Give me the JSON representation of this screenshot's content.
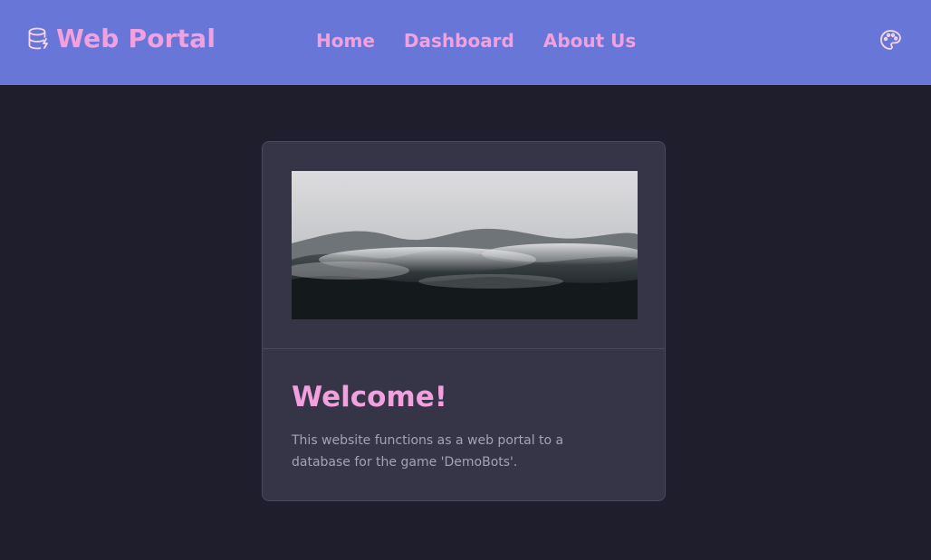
{
  "brand": {
    "title": "Web Portal",
    "icon": "database-bolt-icon"
  },
  "nav": {
    "links": [
      {
        "label": "Home"
      },
      {
        "label": "Dashboard"
      },
      {
        "label": "About Us"
      }
    ],
    "theme_icon": "palette-icon"
  },
  "card": {
    "image": "foggy-forest-mountain-image",
    "title": "Welcome!",
    "text": "This website functions as a web portal to a database for the game 'DemoBots'."
  },
  "colors": {
    "navbar_bg": "#6876d7",
    "page_bg": "#1f1e2d",
    "card_bg": "#363548",
    "accent_pink": "#f3a0df",
    "muted_text": "#a4a3b6"
  }
}
